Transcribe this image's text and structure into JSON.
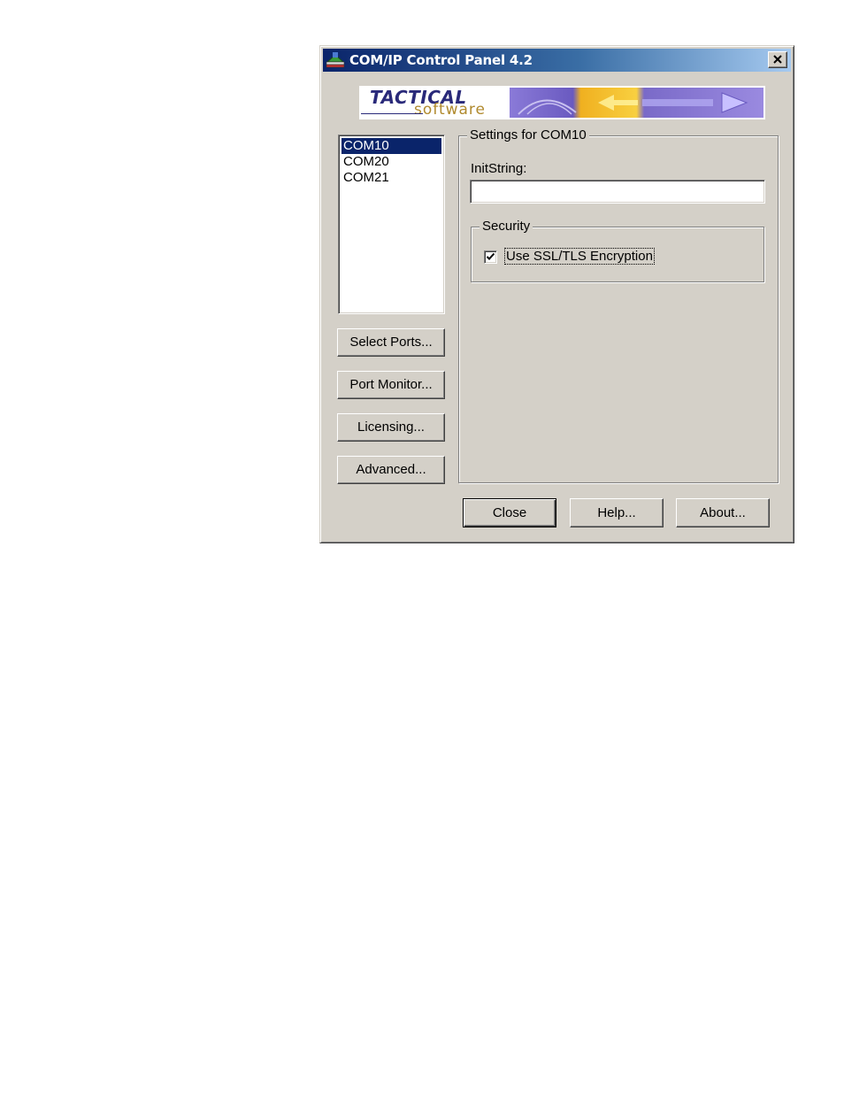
{
  "window": {
    "title": "COM/IP Control Panel 4.2",
    "icon": "network-app-icon",
    "close_icon": "close-icon"
  },
  "logo": {
    "line1": "TACTICAL",
    "line2": "software"
  },
  "ports": {
    "items": [
      "COM10",
      "COM20",
      "COM21"
    ],
    "selected_index": 0
  },
  "buttons": {
    "select_ports": "Select Ports...",
    "port_monitor": "Port Monitor...",
    "licensing": "Licensing...",
    "advanced": "Advanced..."
  },
  "settings": {
    "group_label": "Settings for COM10",
    "initstring_label": "InitString:",
    "initstring_value": "",
    "security": {
      "group_label": "Security",
      "ssl_label": "Use SSL/TLS Encryption",
      "ssl_checked": true
    }
  },
  "footer": {
    "close": "Close",
    "help": "Help...",
    "about": "About..."
  },
  "colors": {
    "title_start": "#0a246a",
    "title_end": "#a6caf0",
    "selection": "#0a246a",
    "face": "#d4d0c8"
  }
}
